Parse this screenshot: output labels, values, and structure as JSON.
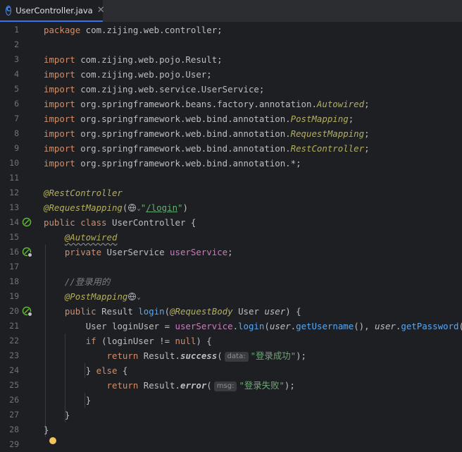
{
  "tab": {
    "icon_letter": "C",
    "filename": "UserController.java",
    "close_symbol": "✕"
  },
  "editor": {
    "line_numbers": [
      "1",
      "2",
      "3",
      "4",
      "5",
      "6",
      "7",
      "8",
      "9",
      "10",
      "11",
      "12",
      "13",
      "14",
      "15",
      "16",
      "17",
      "18",
      "19",
      "20",
      "21",
      "22",
      "23",
      "24",
      "25",
      "26",
      "27",
      "28",
      "29"
    ],
    "code": {
      "l1_kw": "package",
      "l1_rest": " com.zijing.web.controller;",
      "l3_kw": "import",
      "l3_rest": " com.zijing.web.pojo.Result;",
      "l4_kw": "import",
      "l4_rest": " com.zijing.web.pojo.User;",
      "l5_kw": "import",
      "l5_rest": " com.zijing.web.service.UserService;",
      "l6_kw": "import",
      "l6_pre": " org.springframework.beans.factory.annotation.",
      "l6_cls": "Autowired",
      "l6_end": ";",
      "l7_kw": "import",
      "l7_pre": " org.springframework.web.bind.annotation.",
      "l7_cls": "PostMapping",
      "l7_end": ";",
      "l8_kw": "import",
      "l8_pre": " org.springframework.web.bind.annotation.",
      "l8_cls": "RequestMapping",
      "l8_end": ";",
      "l9_kw": "import",
      "l9_pre": " org.springframework.web.bind.annotation.",
      "l9_cls": "RestController",
      "l9_end": ";",
      "l10_kw": "import",
      "l10_rest": " org.springframework.web.bind.annotation.*;",
      "l12_ann": "@RestController",
      "l13_ann": "@RequestMapping",
      "l13_open": "(",
      "l13_q1": "\"",
      "l13_path": "/login",
      "l13_q2": "\"",
      "l13_close": ")",
      "l14_kw": "public class",
      "l14_rest": " UserController {",
      "l15_ann": "@Autowired",
      "l16_kw": "private",
      "l16_type": " UserService ",
      "l16_field": "userService",
      "l16_end": ";",
      "l18_comment": "//登录用的",
      "l19_ann": "@PostMapping",
      "l20_kw": "public",
      "l20_type": " Result ",
      "l20_method": "login",
      "l20_open": "(",
      "l20_ann": "@RequestBody",
      "l20_ptype": " User ",
      "l20_param": "user",
      "l20_end": ") {",
      "l21_type": "User loginUser = ",
      "l21_field": "userService",
      "l21_dot": ".",
      "l21_m1": "login",
      "l21_open": "(",
      "l21_p1": "user",
      "l21_d1": ".",
      "l21_m2": "getUsername",
      "l21_mid": "(), ",
      "l21_p2": "user",
      "l21_d2": ".",
      "l21_m3": "getPassword",
      "l21_end": "());",
      "l22_kw": "if",
      "l22_mid": " (loginUser != ",
      "l22_null": "null",
      "l22_end": ") {",
      "l23_kw": "return",
      "l23_cls": " Result.",
      "l23_m": "success",
      "l23_open": "(",
      "l23_hint": "data:",
      "l23_str": "\"登录成功\"",
      "l23_end": ");",
      "l24_close": "} ",
      "l24_kw": "else",
      "l24_end": " {",
      "l25_kw": "return",
      "l25_cls": " Result.",
      "l25_m": "error",
      "l25_open": "(",
      "l25_hint": "msg:",
      "l25_str": "\"登录失败\"",
      "l25_end": ");",
      "l26_close": "}",
      "l27_close": "}",
      "l28_close": "}"
    }
  },
  "colors": {
    "background": "#1e1f22",
    "keyword": "#cf8e6d",
    "annotation": "#b3ae60",
    "string": "#6aab73",
    "method": "#56a8f5",
    "field": "#c77dbb",
    "comment": "#7a7e85",
    "line_number": "#6f737a"
  },
  "gutter_icons": [
    "bean-icon",
    "autowired-bean-icon",
    "web-endpoint-icon",
    "intention-bulb-icon"
  ]
}
